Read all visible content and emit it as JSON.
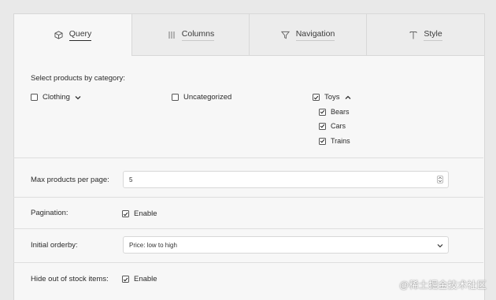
{
  "tabs": [
    {
      "label": "Query",
      "icon": "cube-icon",
      "active": true
    },
    {
      "label": "Columns",
      "icon": "columns-icon",
      "active": false
    },
    {
      "label": "Navigation",
      "icon": "filter-icon",
      "active": false
    },
    {
      "label": "Style",
      "icon": "text-style-icon",
      "active": false
    }
  ],
  "category": {
    "heading": "Select products by category:",
    "items": [
      {
        "label": "Clothing",
        "checked": false,
        "expandable": true,
        "expanded": false
      },
      {
        "label": "Uncategorized",
        "checked": false
      },
      {
        "label": "Toys",
        "checked": true,
        "expandable": true,
        "expanded": true,
        "children": [
          {
            "label": "Bears",
            "checked": true
          },
          {
            "label": "Cars",
            "checked": true
          },
          {
            "label": "Trains",
            "checked": true
          }
        ]
      }
    ]
  },
  "max_products": {
    "label": "Max products per page:",
    "value": "5"
  },
  "pagination": {
    "label": "Pagination:",
    "option": "Enable",
    "checked": true
  },
  "orderby": {
    "label": "Initial orderby:",
    "value": "Price: low to high"
  },
  "hide_out_of_stock": {
    "label": "Hide out of stock items:",
    "option": "Enable",
    "checked": true
  },
  "watermark": "@稀土掘金技术社区",
  "colors": {
    "accent": "#2b2b2b",
    "panel": "#f7f7f7",
    "tab_inactive": "#ececec",
    "border": "#d8d8d8"
  }
}
